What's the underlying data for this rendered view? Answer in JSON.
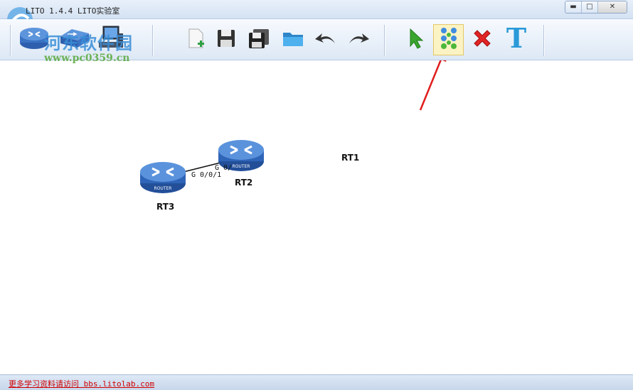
{
  "window": {
    "title": "LITO 1.4.4  LITO实验室",
    "controls": {
      "minimize": "▬",
      "maximize": "□",
      "close": "✕"
    }
  },
  "watermark": {
    "title": "河东软件园",
    "url": "www.pc0359.cn"
  },
  "toolbar": {
    "device_icons": [
      "router-icon",
      "switch-icon",
      "pc-icon"
    ],
    "tools": [
      {
        "name": "new-file-icon"
      },
      {
        "name": "save-icon"
      },
      {
        "name": "save-as-icon"
      },
      {
        "name": "open-folder-icon"
      },
      {
        "name": "undo-icon"
      },
      {
        "name": "redo-icon"
      },
      {
        "name": "select-pointer-icon"
      },
      {
        "name": "connect-link-icon",
        "active": true
      },
      {
        "name": "delete-icon"
      },
      {
        "name": "text-icon",
        "label": "T"
      }
    ]
  },
  "topology": {
    "nodes": [
      {
        "id": "RT1",
        "label": "RT1"
      },
      {
        "id": "RT2",
        "label": "RT2"
      },
      {
        "id": "RT3",
        "label": "RT3"
      }
    ],
    "links": [
      {
        "from": "RT3",
        "to": "RT2",
        "from_port": "G 0/0/1",
        "to_port": "G 0/"
      }
    ],
    "router_badge": "ROUTER"
  },
  "status": {
    "link_text": "更多学习资料请访问 bbs.litolab.com"
  },
  "colors": {
    "accent_blue": "#3a6fb8",
    "link_red": "#d00000",
    "arrow_red": "#e01c1c"
  }
}
